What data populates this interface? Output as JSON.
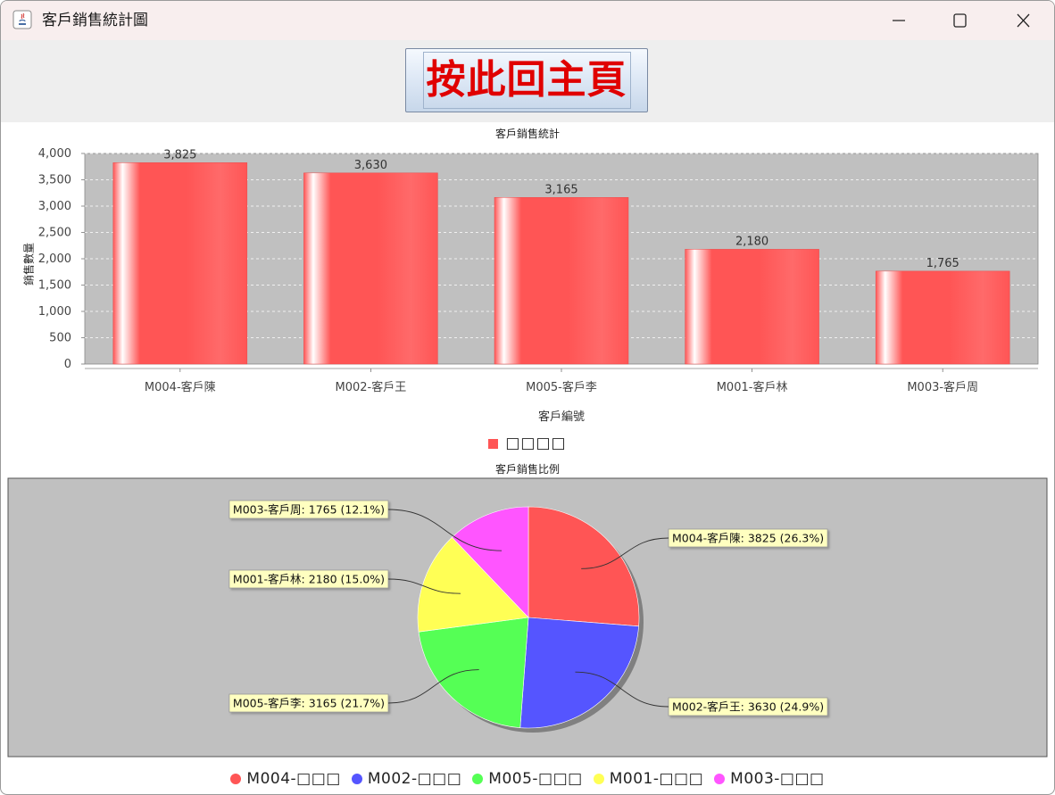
{
  "window": {
    "title": "客戶銷售統計圖"
  },
  "home_button": {
    "label": "按此回主頁"
  },
  "colors": {
    "bar": "#ff5555",
    "plot_bg": "#c0c0c0",
    "title_bar": "#f8eeee"
  },
  "icons": {
    "app": "java-icon",
    "minimize": "minimize-icon",
    "maximize": "maximize-icon",
    "close": "close-icon"
  },
  "chart_data": [
    {
      "type": "bar",
      "title": "客戶銷售統計",
      "xlabel": "客戶編號",
      "ylabel": "銷售數量",
      "categories": [
        "M004-客戶陳",
        "M002-客戶王",
        "M005-客戶李",
        "M001-客戶林",
        "M003-客戶周"
      ],
      "values": [
        3825,
        3630,
        3165,
        2180,
        1765
      ],
      "value_labels": [
        "3,825",
        "3,630",
        "3,165",
        "2,180",
        "1,765"
      ],
      "ylim": [
        0,
        4000
      ],
      "yticks": [
        "0",
        "500",
        "1,000",
        "1,500",
        "2,000",
        "2,500",
        "3,000",
        "3,500",
        "4,000"
      ],
      "grid": true,
      "legend": {
        "placement": "bottom",
        "label": "□□□□",
        "color": "#ff5555"
      }
    },
    {
      "type": "pie",
      "title": "客戶銷售比例",
      "slices": [
        {
          "key": "M004",
          "label": "M004-客戶陳: 3825 (26.3%)",
          "value": 3825,
          "color": "#ff5555"
        },
        {
          "key": "M002",
          "label": "M002-客戶王: 3630 (24.9%)",
          "value": 3630,
          "color": "#5555ff"
        },
        {
          "key": "M005",
          "label": "M005-客戶李: 3165 (21.7%)",
          "value": 3165,
          "color": "#55ff55"
        },
        {
          "key": "M001",
          "label": "M001-客戶林: 2180 (15.0%)",
          "value": 2180,
          "color": "#ffff55"
        },
        {
          "key": "M003",
          "label": "M003-客戶周: 1765 (12.1%)",
          "value": 1765,
          "color": "#ff55ff"
        }
      ],
      "legend": {
        "placement": "bottom",
        "items": [
          {
            "label": "M004-□□□",
            "color": "#ff5555"
          },
          {
            "label": "M002-□□□",
            "color": "#5555ff"
          },
          {
            "label": "M005-□□□",
            "color": "#55ff55"
          },
          {
            "label": "M001-□□□",
            "color": "#ffff55"
          },
          {
            "label": "M003-□□□",
            "color": "#ff55ff"
          }
        ]
      }
    }
  ]
}
